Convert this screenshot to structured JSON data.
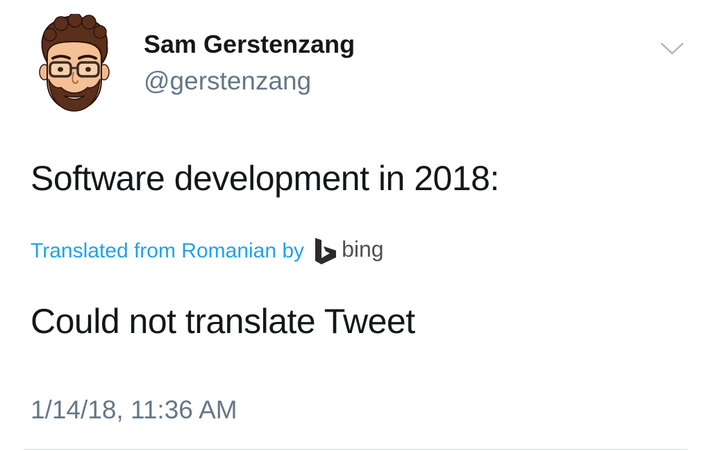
{
  "tweet": {
    "author": {
      "display_name": "Sam Gerstenzang",
      "handle": "@gerstenzang",
      "avatar_icon": "bitmoji-avatar-icon"
    },
    "menu_icon": "chevron-down-icon",
    "text": "Software development in 2018:",
    "translation_notice": {
      "label": "Translated from Romanian by",
      "provider_icon": "bing-logo-icon",
      "provider": "bing"
    },
    "translation_text": "Could not translate Tweet",
    "timestamp": "1/14/18, 11:36 AM"
  },
  "colors": {
    "text_primary": "#14171a",
    "text_secondary": "#657786",
    "link_blue": "#1da1f2",
    "divider": "#d3d8dc"
  }
}
